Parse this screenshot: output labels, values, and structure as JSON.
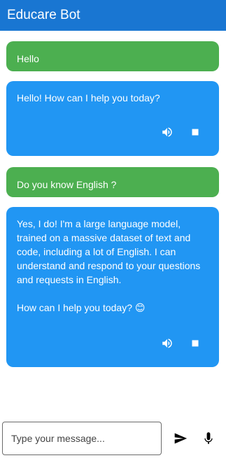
{
  "app": {
    "title": "Educare Bot"
  },
  "messages": [
    {
      "role": "user",
      "text": "Hello"
    },
    {
      "role": "bot",
      "text": "Hello! How can I help you today?"
    },
    {
      "role": "user",
      "text": "Do you know English ?"
    },
    {
      "role": "bot",
      "text": "Yes, I do! I'm a large language model, trained on a massive dataset of text and code, including a lot of English. I can understand and respond to your questions and requests in English.\n\nHow can I help you today? 😊"
    }
  ],
  "composer": {
    "placeholder": "Type your message..."
  },
  "icons": {
    "speaker": "volume-icon",
    "stop": "stop-icon",
    "send": "send-icon",
    "mic": "microphone-icon"
  },
  "colors": {
    "appbar": "#1976d2",
    "user_bubble": "#4caf50",
    "bot_bubble": "#2196f3"
  }
}
